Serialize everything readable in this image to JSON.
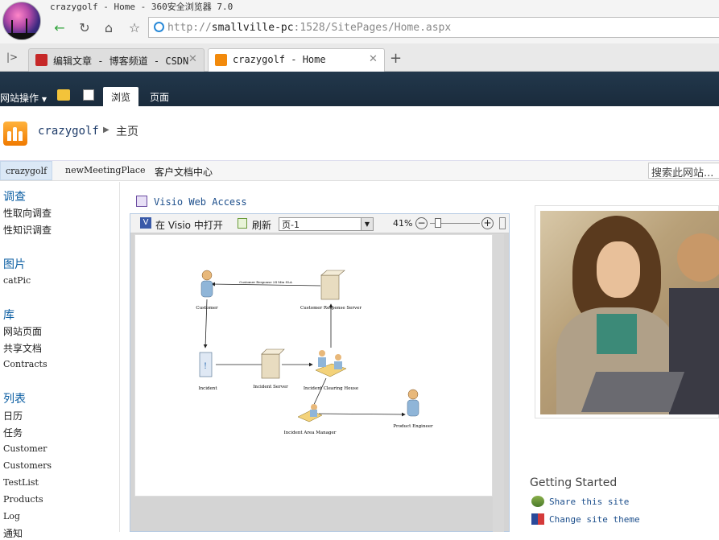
{
  "window": {
    "title": "crazygolf - Home - 360安全浏览器 7.0"
  },
  "addressbar": {
    "url_prefix": "http://",
    "url_host": "smallville-pc",
    "url_rest": ":1528/SitePages/Home.aspx"
  },
  "tabs": [
    {
      "label": "编辑文章 - 博客频道 - CSDN"
    },
    {
      "label": "crazygolf - Home"
    }
  ],
  "ribbon": {
    "site_actions": "网站操作",
    "tabs": [
      "浏览",
      "页面"
    ]
  },
  "header": {
    "site_name": "crazygolf",
    "page_name": "主页"
  },
  "topnav": {
    "items": [
      "crazygolf",
      "newMeetingPlace",
      "客户文档中心"
    ],
    "search_placeholder": "搜索此网站..."
  },
  "leftnav": {
    "sections": [
      {
        "heading": "调查",
        "items": [
          "性取向调查",
          "性知识调查"
        ]
      },
      {
        "heading": "图片",
        "items": [
          "catPic"
        ]
      },
      {
        "heading": "库",
        "items": [
          "网站页面",
          "共享文档",
          "Contracts"
        ]
      },
      {
        "heading": "列表",
        "items": [
          "日历",
          "任务",
          "Customer",
          "Customers",
          "TestList",
          "Products",
          "Log",
          "通知"
        ]
      }
    ]
  },
  "webpart": {
    "title": "Visio Web Access",
    "toolbar": {
      "open_in_visio": "在 Visio 中打开",
      "refresh": "刷新",
      "page_select": "页-1",
      "zoom": "41%"
    },
    "diagram": {
      "nodes": [
        "Customer",
        "Customer Response Server",
        "Incident",
        "Incident Server",
        "Incident Clearing House",
        "Product Engineer",
        "Incident Area Manager"
      ],
      "edge_label": "Customer Response 24 Min SLA"
    }
  },
  "getting_started": {
    "title": "Getting Started",
    "items": [
      "Share this site",
      "Change site theme"
    ]
  },
  "colors": {
    "ribbon": "#21374c",
    "link": "#1d4f8c",
    "accent": "#0d5fa3"
  }
}
